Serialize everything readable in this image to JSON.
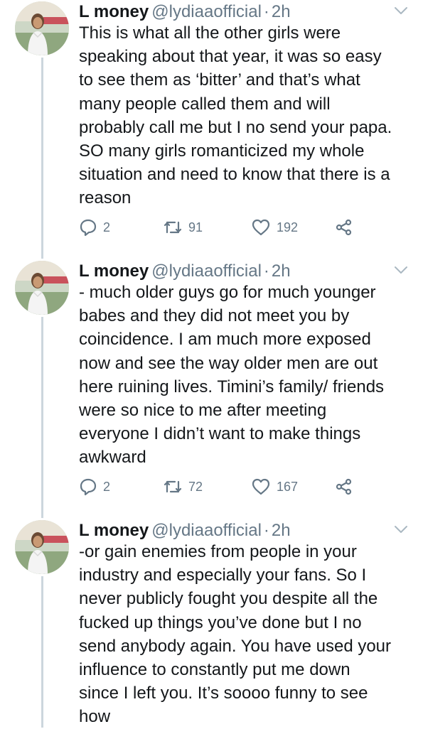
{
  "tweets": [
    {
      "name": "L money",
      "handle": "@lydiaaofficial",
      "separator": "·",
      "time": "2h",
      "text": "This is what all the other girls were\nspeaking about that year, it was so easy\nto see them as ‘bitter’ and that’s what\nmany people called them and will\nprobably call me but I no send your papa.\nSO many girls romanticized my whole\nsituation and need to know that there is a\nreason",
      "replies": "2",
      "retweets": "91",
      "likes": "192"
    },
    {
      "name": "L money",
      "handle": "@lydiaaofficial",
      "separator": "·",
      "time": "2h",
      "text": "- much older guys go for much younger\nbabes and they did not meet you by\ncoincidence. I am much more exposed\nnow and see the way older men are out\nhere ruining lives. Timini’s family/ friends\nwere so nice to me after meeting\neveryone I didn’t want to make things\nawkward",
      "replies": "2",
      "retweets": "72",
      "likes": "167"
    },
    {
      "name": "L money",
      "handle": "@lydiaaofficial",
      "separator": "·",
      "time": "2h",
      "text": "-or gain enemies from people in your\nindustry and especially your fans. So I\nnever publicly fought you despite all the\nfucked up things you’ve done but I no\nsend anybody again. You have used your\ninfluence to constantly put me down\nsince I left you. It’s soooo funny to see\nhow"
    }
  ],
  "icons": {
    "reply": "reply-icon",
    "retweet": "retweet-icon",
    "like": "heart-icon",
    "share": "share-icon",
    "menu": "chevron-down-icon"
  },
  "colors": {
    "text": "#14171a",
    "secondary": "#657786",
    "thread_line": "#ccd6dd",
    "background": "#ffffff"
  }
}
